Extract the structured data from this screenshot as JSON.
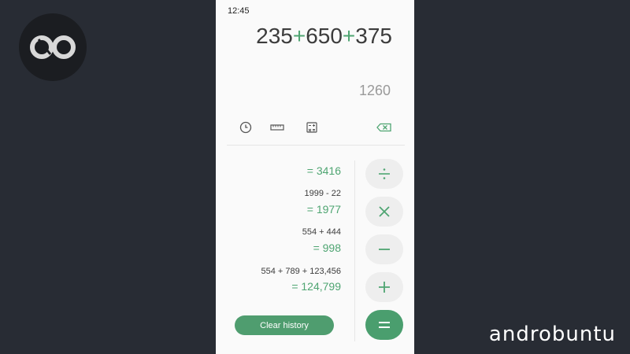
{
  "watermark": {
    "brand": "androbuntu"
  },
  "status_bar": {
    "time": "12:45"
  },
  "display": {
    "operands": [
      "235",
      "650",
      "375"
    ],
    "operator": "+",
    "result": "1260"
  },
  "toolbar": {
    "icons": [
      "history-icon",
      "unit-converter-icon",
      "scientific-calculator-icon",
      "backspace-icon"
    ]
  },
  "history": [
    {
      "expression": "",
      "result": "= 3416"
    },
    {
      "expression": "1999 - 22",
      "result": "= 1977"
    },
    {
      "expression": "554 + 444",
      "result": "= 998"
    },
    {
      "expression": "554 + 789 + 123,456",
      "result": "= 124,799"
    }
  ],
  "buttons": {
    "clear_history": "Clear history",
    "operators": [
      "divide",
      "multiply",
      "subtract",
      "add",
      "equals"
    ]
  },
  "colors": {
    "accent": "#4fa572",
    "equals_bg": "#4a9e6e",
    "page_bg": "#282c34",
    "phone_bg": "#fafafa"
  }
}
